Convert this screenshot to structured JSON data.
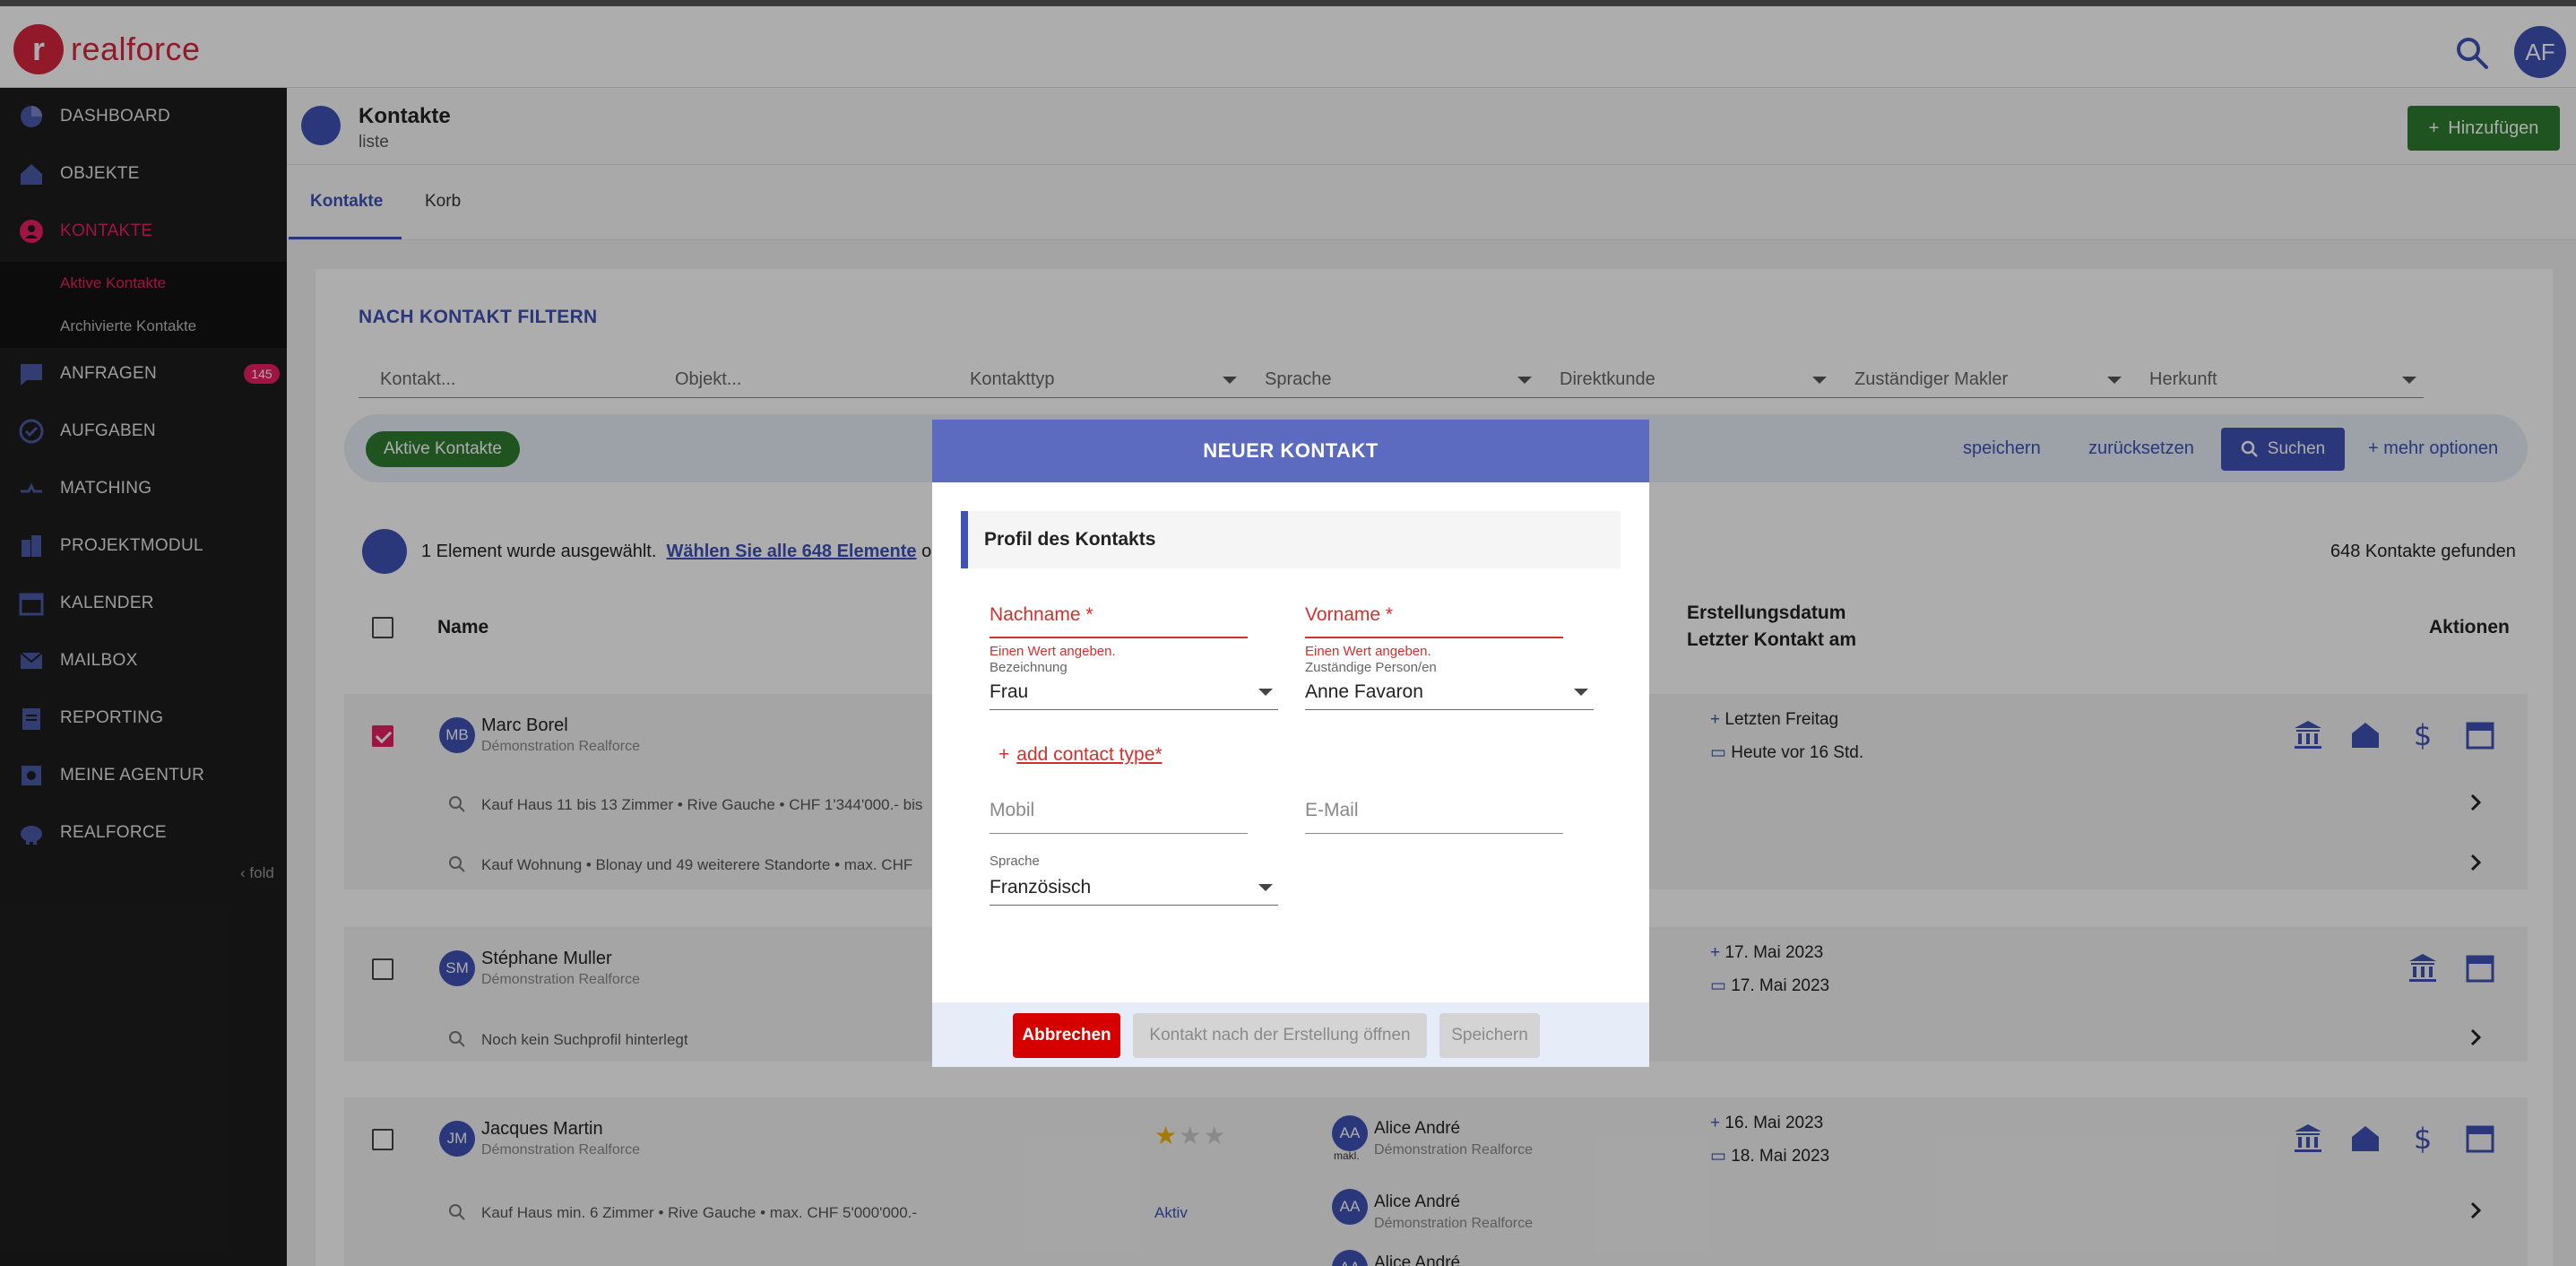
{
  "app": {
    "logo_text": "realforce",
    "logo_glyph": "r",
    "avatar": "AF"
  },
  "sidebar": {
    "items": [
      {
        "label": "DASHBOARD",
        "icon": "pie-chart-icon"
      },
      {
        "label": "OBJEKTE",
        "icon": "house-icon"
      },
      {
        "label": "KONTAKTE",
        "icon": "person-circle-icon"
      },
      {
        "label": "ANFRAGEN",
        "icon": "message-icon",
        "badge": "145"
      },
      {
        "label": "AUFGABEN",
        "icon": "check-circle-icon"
      },
      {
        "label": "MATCHING",
        "icon": "matching-icon"
      },
      {
        "label": "PROJEKTMODUL",
        "icon": "building-icon"
      },
      {
        "label": "KALENDER",
        "icon": "calendar-icon"
      },
      {
        "label": "MAILBOX",
        "icon": "mail-icon"
      },
      {
        "label": "REPORTING",
        "icon": "clipboard-icon"
      },
      {
        "label": "MEINE AGENTUR",
        "icon": "agency-icon"
      },
      {
        "label": "REALFORCE",
        "icon": "piggy-bank-icon"
      }
    ],
    "subitems": [
      "Aktive Kontakte",
      "Archivierte Kontakte"
    ],
    "fold": "fold"
  },
  "header": {
    "title": "Kontakte",
    "subtitle": "liste",
    "add_label": "Hinzufügen"
  },
  "tabs": [
    "Kontakte",
    "Korb"
  ],
  "filter": {
    "title": "NACH KONTAKT FILTERN",
    "fields": [
      "Kontakt...",
      "Objekt...",
      "Kontakttyp",
      "Sprache",
      "Direktkunde",
      "Zuständiger Makler",
      "Herkunft"
    ],
    "chip": "Aktive Kontakte",
    "save": "speichern",
    "reset": "zurücksetzen",
    "search": "Suchen",
    "more": "+ mehr optionen"
  },
  "selection": {
    "text": "1 Element wurde ausgewählt.",
    "link": "Wählen Sie alle 648 Elemente",
    "suffix": "oder",
    "found": "648 Kontakte gefunden"
  },
  "table": {
    "headers": {
      "name": "Name",
      "created": "Erstellungsdatum",
      "last": "Letzter Kontakt am",
      "actions": "Aktionen"
    },
    "rows": [
      {
        "initials": "MB",
        "name": "Marc Borel",
        "agency": "Démonstration Realforce",
        "created": "Letzten Freitag",
        "last": "Heute vor 16 Std.",
        "searches": [
          "Kauf Haus 11 bis 13 Zimmer • Rive Gauche • CHF 1'344'000.- bis",
          "Kauf Wohnung • Blonay und 49 weiterere Standorte • max. CHF"
        ]
      },
      {
        "initials": "SM",
        "name": "Stéphane Muller",
        "agency": "Démonstration Realforce",
        "created": "17. Mai 2023",
        "last": "17. Mai 2023",
        "searches": [
          "Noch kein Suchprofil hinterlegt"
        ]
      },
      {
        "initials": "JM",
        "name": "Jacques Martin",
        "agency": "Démonstration Realforce",
        "created": "16. Mai 2023",
        "last": "18. Mai 2023",
        "broker_initials": "AA",
        "broker_name": "Alice André",
        "broker_agency": "Démonstration Realforce",
        "broker_tag": "makl.",
        "searches": [
          "Kauf Haus min. 6 Zimmer • Rive Gauche • max. CHF 5'000'000.-"
        ],
        "search_status": "Aktiv",
        "rating": 1,
        "broker2_name": "Alice André",
        "broker2_agency": "Démonstration Realforce",
        "broker3_name": "Alice André"
      }
    ]
  },
  "modal": {
    "title": "NEUER KONTAKT",
    "section": "Profil des Kontakts",
    "lastname": "Nachname *",
    "firstname": "Vorname *",
    "error": "Einen Wert angeben.",
    "salutation_label": "Bezeichnung",
    "salutation_value": "Frau",
    "person_label": "Zuständige Person/en",
    "person_value": "Anne Favaron",
    "add_contact_type": "add contact type*",
    "mobile": "Mobil",
    "email": "E-Mail",
    "language_label": "Sprache",
    "language_value": "Französisch",
    "cancel": "Abbrechen",
    "open_after": "Kontakt nach der Erstellung öffnen",
    "save": "Speichern"
  },
  "colors": {
    "primary": "#3f51b5",
    "accent": "#e91e63",
    "green": "#2e7d32",
    "danger": "#d50000",
    "modal_header": "#5c6bc0"
  }
}
